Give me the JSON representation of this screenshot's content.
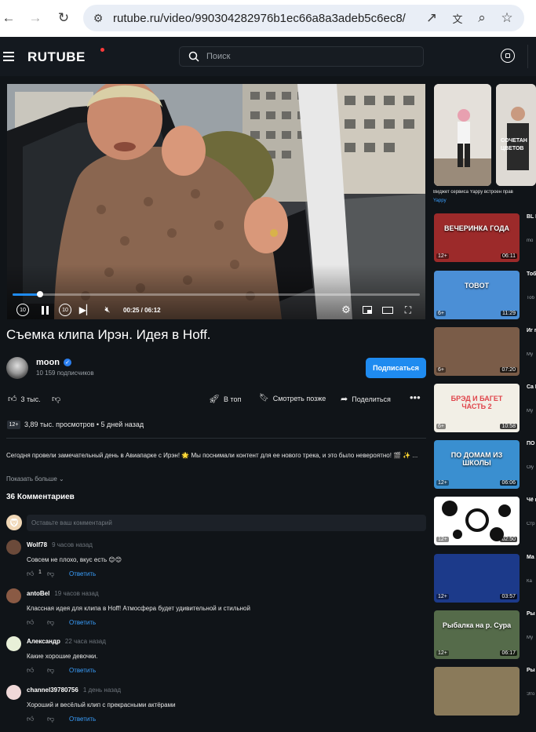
{
  "browser": {
    "url": "rutube.ru/video/990304282976b1ec66a8a3adeb5c6ec8/"
  },
  "site": {
    "logo": "RUTUBE",
    "search_placeholder": "Поиск"
  },
  "player": {
    "time": "00:25 / 06:12",
    "progress": 0.067,
    "skip_back_label": "10",
    "skip_forward_label": "10"
  },
  "video": {
    "title": "Съемка клипа Ирэн. Идея в Hoff.",
    "channel": "moon",
    "subscribers": "10 159 подписчиков",
    "subscribe_label": "Подписаться",
    "likes": "3 тыс.",
    "actions": {
      "top": "В топ",
      "watch_later": "Смотреть позже",
      "share": "Поделиться"
    },
    "age": "12+",
    "stats": "3,89 тыс. просмотров  •  5 дней назад",
    "description": "Сегодня провели замечательный день в Авиапарке с Ирэн! 🌟 Мы поснимали контент для ее нового трека, и это было невероятно! 🎬 ✨ ...",
    "show_more": "Показать больше"
  },
  "comments": {
    "count_label": "36 Комментариев",
    "input_placeholder": "Оставьте ваш комментарий",
    "reply_label": "Ответить",
    "items": [
      {
        "author": "Wolf78",
        "time": "9 часов назад",
        "text": "Совсем не плохо, вкус есть 😊😊",
        "likes": "1",
        "avatar_color": "#6b4a3a"
      },
      {
        "author": "antoBel",
        "time": "19 часов назад",
        "text": "Классная идея для клипа в Hoff! Атмосфера будет удивительной и стильной",
        "likes": "",
        "avatar_color": "#8a5a44"
      },
      {
        "author": "Александр",
        "time": "22 часа назад",
        "text": "Какие хорошие девочки.",
        "likes": "",
        "avatar_color": "#e8f0d8"
      },
      {
        "author": "channel39780756",
        "time": "1 день назад",
        "text": "Хороший и весёлый клип с прекрасными актёрами",
        "likes": "",
        "avatar_color": "#f0d8d8"
      }
    ]
  },
  "sidebar": {
    "shorts_caption": "Виджет сервиса Yappy встроен прав",
    "shorts_brand": "Yappy",
    "shorts_text": "СОЧЕТАН ЦВЕТОВ",
    "videos": [
      {
        "title": "BL ЮL",
        "meta": "mo",
        "age": "12+",
        "duration": "06:11",
        "thumb_text": "ВЕЧЕРИНКА ГОДА",
        "color": "#9c2a2a"
      },
      {
        "title": "Тоб се",
        "meta": "Тоб",
        "age": "6+",
        "duration": "11:29",
        "thumb_text": "TOBOT",
        "color": "#4b8fd6"
      },
      {
        "title": "Иг по",
        "meta": "Му",
        "age": "6+",
        "duration": "07:20",
        "thumb_text": "",
        "color": "#7a5c48"
      },
      {
        "title": "Сa Бр",
        "meta": "Му",
        "age": "6+",
        "duration": "10:58",
        "thumb_text": "БРЭД И БАГЕТ ЧАСТЬ 2",
        "color": "#f2efe6"
      },
      {
        "title": "ПО РИ",
        "meta": "Oly",
        "age": "12+",
        "duration": "06:06",
        "thumb_text": "ПО ДОМАМ ИЗ ШКОЛЫ",
        "color": "#3a8fd0"
      },
      {
        "title": "Чё кар",
        "meta": "Стр",
        "age": "12+",
        "duration": "02:50",
        "thumb_text": "",
        "color": "#ffffff"
      },
      {
        "title": "Ma Ха",
        "meta": "Ка",
        "age": "12+",
        "duration": "03:57",
        "thumb_text": "",
        "color": "#1c3a8a"
      },
      {
        "title": "Ры Час",
        "meta": "Му",
        "age": "12+",
        "duration": "06:17",
        "thumb_text": "Рыбалка на р. Сура",
        "color": "#556b4a"
      },
      {
        "title": "Ры аэр",
        "meta": "Это",
        "age": "",
        "duration": "",
        "thumb_text": "",
        "color": "#8a7a5a"
      }
    ]
  }
}
